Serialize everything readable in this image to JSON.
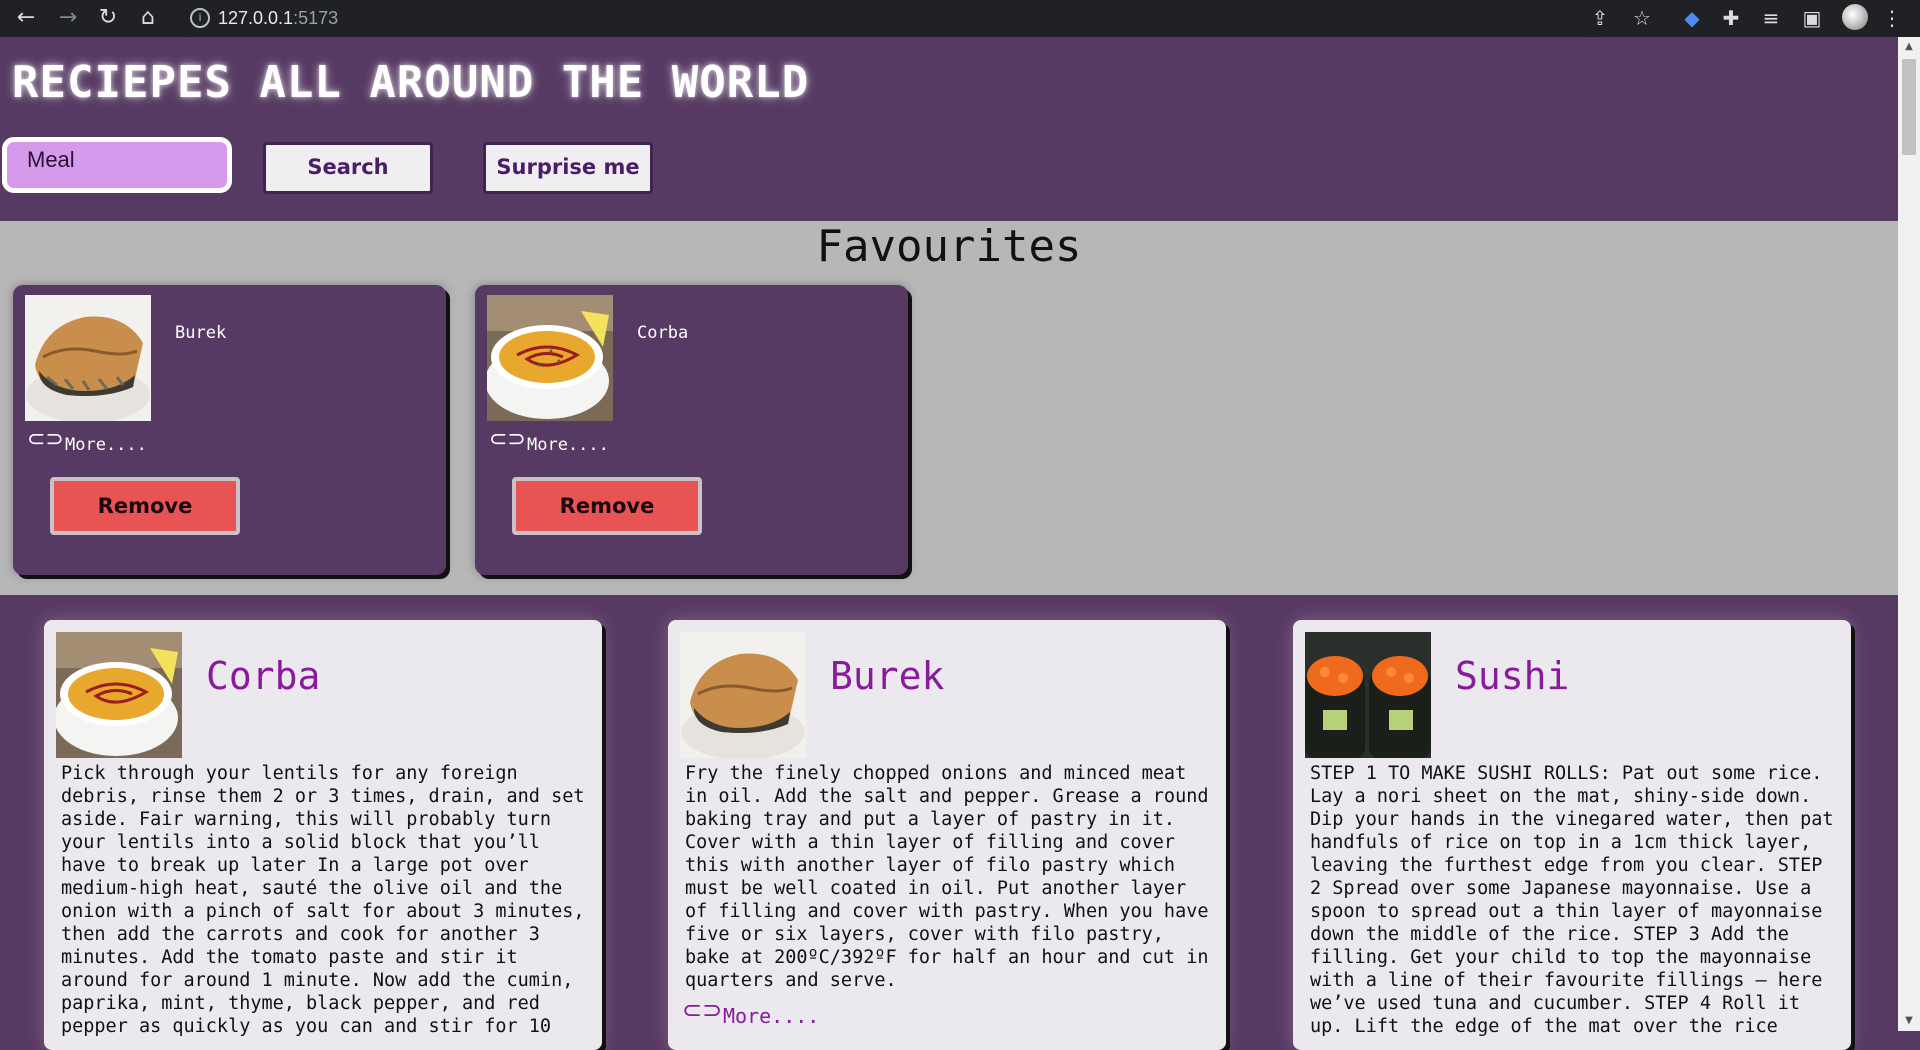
{
  "browser": {
    "url_host": "127.0.0.1",
    "url_port": ":5173",
    "icons": [
      "back-arrow-icon",
      "forward-arrow-icon",
      "reload-icon",
      "home-icon",
      "site-info-icon",
      "share-icon",
      "bookmark-star-icon",
      "extension-icon",
      "puzzle-icon",
      "reading-list-icon",
      "side-panel-icon",
      "profile-avatar-icon",
      "kebab-menu-icon"
    ]
  },
  "header": {
    "title": "RECIEPES ALL AROUND THE WORLD",
    "search_value": "Meal",
    "search_label": "Search",
    "surprise_label": "Surprise me"
  },
  "favourites": {
    "heading": "Favourites",
    "items": [
      {
        "name": "Burek",
        "more": "More....",
        "remove": "Remove",
        "image": "burek"
      },
      {
        "name": "Corba",
        "more": "More....",
        "remove": "Remove",
        "image": "corba"
      }
    ]
  },
  "recipes": [
    {
      "title": "Corba",
      "image": "corba",
      "text": "Pick through your lentils for any foreign debris, rinse them 2 or 3 times, drain, and set aside. Fair warning, this will probably turn your lentils into a solid block that you’ll have to break up later In a large pot over medium-high heat, sauté the olive oil and the onion with a pinch of salt for about 3 minutes, then add the carrots and cook for another 3 minutes. Add the tomato paste and stir it around for around 1 minute. Now add the cumin, paprika, mint, thyme, black pepper, and red pepper as quickly as you can and stir for 10",
      "more": ""
    },
    {
      "title": "Burek",
      "image": "burek",
      "text": "Fry the finely chopped onions and minced meat in oil. Add the salt and pepper. Grease a round baking tray and put a layer of pastry in it. Cover with a thin layer of filling and cover this with another layer of filo pastry which must be well coated in oil. Put another layer of filling and cover with pastry. When you have five or six layers, cover with filo pastry, bake at 200ºC/392ºF for half an hour and cut in quarters and serve.",
      "more": "More...."
    },
    {
      "title": "Sushi",
      "image": "sushi",
      "text": "STEP 1 TO MAKE SUSHI ROLLS: Pat out some rice. Lay a nori sheet on the mat, shiny-side down. Dip your hands in the vinegared water, then pat handfuls of rice on top in a 1cm thick layer, leaving the furthest edge from you clear. STEP 2 Spread over some Japanese mayonnaise. Use a spoon to spread out a thin layer of mayonnaise down the middle of the rice. STEP 3 Add the filling. Get your child to top the mayonnaise with a line of their favourite fillings – here we’ve used tuna and cucumber. STEP 4 Roll it up. Lift the edge of the mat over the rice",
      "more": ""
    }
  ]
}
